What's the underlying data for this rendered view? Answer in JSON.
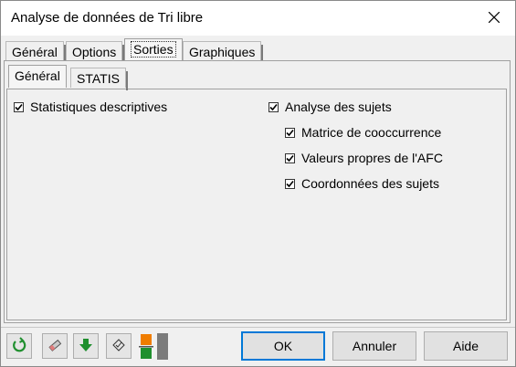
{
  "window": {
    "title": "Analyse de données de Tri libre",
    "close_glyph": "✕"
  },
  "tabs": [
    "Général",
    "Options",
    "Sorties",
    "Graphiques"
  ],
  "subtabs": [
    "Général",
    "STATIS"
  ],
  "left_options": [
    {
      "label": "Statistiques descriptives",
      "checked": true
    }
  ],
  "right_options": [
    {
      "label": "Analyse des sujets",
      "checked": true
    },
    {
      "label": "Matrice de cooccurrence",
      "checked": true
    },
    {
      "label": "Valeurs propres de l'AFC",
      "checked": true
    },
    {
      "label": "Coordonnées des sujets",
      "checked": true
    }
  ],
  "toolbar": {
    "icons": [
      "reset-icon",
      "eraser-icon",
      "download-arrow-icon",
      "deselect-icon",
      "orange-green-toggle-icon"
    ],
    "colors": {
      "green": "#1f8f2e",
      "orange": "#f07d00",
      "gray": "#7b7b7b"
    }
  },
  "buttons": {
    "ok": "OK",
    "cancel": "Annuler",
    "help": "Aide"
  }
}
